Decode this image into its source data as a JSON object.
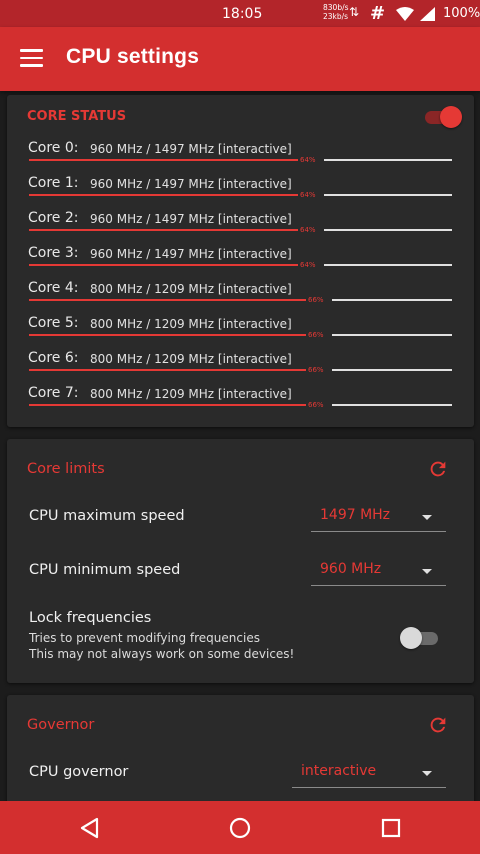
{
  "status_bar": {
    "time": "18:05",
    "net_up": "830b/s",
    "net_down": "23kb/s",
    "arrows": "⇅",
    "hash": "#",
    "battery": "100%"
  },
  "app_bar": {
    "title": "CPU settings"
  },
  "core_status": {
    "header": "CORE STATUS",
    "enabled": true,
    "cores": [
      {
        "label": "Core 0:",
        "freq": "960 MHz / 1497 MHz [interactive]",
        "percent": 64,
        "percent_label": "64%"
      },
      {
        "label": "Core 1:",
        "freq": "960 MHz / 1497 MHz [interactive]",
        "percent": 64,
        "percent_label": "64%"
      },
      {
        "label": "Core 2:",
        "freq": "960 MHz / 1497 MHz [interactive]",
        "percent": 64,
        "percent_label": "64%"
      },
      {
        "label": "Core 3:",
        "freq": "960 MHz / 1497 MHz [interactive]",
        "percent": 64,
        "percent_label": "64%"
      },
      {
        "label": "Core 4:",
        "freq": "800 MHz / 1209 MHz [interactive]",
        "percent": 66,
        "percent_label": "66%"
      },
      {
        "label": "Core 5:",
        "freq": "800 MHz / 1209 MHz [interactive]",
        "percent": 66,
        "percent_label": "66%"
      },
      {
        "label": "Core 6:",
        "freq": "800 MHz / 1209 MHz [interactive]",
        "percent": 66,
        "percent_label": "66%"
      },
      {
        "label": "Core 7:",
        "freq": "800 MHz / 1209 MHz [interactive]",
        "percent": 66,
        "percent_label": "66%"
      }
    ]
  },
  "core_limits": {
    "header": "Core limits",
    "max_speed_label": "CPU maximum speed",
    "max_speed_value": "1497 MHz",
    "min_speed_label": "CPU minimum speed",
    "min_speed_value": "960 MHz",
    "lock_label": "Lock frequencies",
    "lock_desc_1": "Tries to prevent modifying frequencies",
    "lock_desc_2": "This may not always work on some devices!",
    "lock_enabled": false
  },
  "governor": {
    "header": "Governor",
    "governor_label": "CPU governor",
    "governor_value": "interactive"
  },
  "colors": {
    "accent": "#e53935",
    "app_bar": "#d32f2f",
    "status_bar": "#b3252a",
    "card": "#2a2a2a",
    "background": "#1c1c1c"
  },
  "icons": {
    "menu": "hamburger-icon",
    "refresh": "refresh-icon",
    "back": "back-triangle-icon",
    "home": "home-circle-icon",
    "recents": "recents-square-icon"
  }
}
